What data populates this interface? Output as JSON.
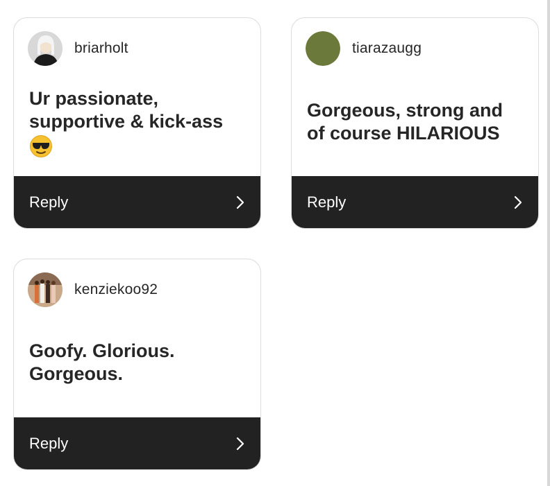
{
  "cards": [
    {
      "username": "briarholt",
      "message": "Ur passionate, supportive & kick-ass",
      "emoji": "sunglasses-emoji",
      "reply_label": "Reply",
      "avatar": "photo-portrait"
    },
    {
      "username": "tiarazaugg",
      "message": "Gorgeous, strong and of course HILARIOUS",
      "reply_label": "Reply",
      "avatar_color": "#6b7a3a"
    },
    {
      "username": "kenziekoo92",
      "message": "Goofy. Glorious. Gorgeous.",
      "reply_label": "Reply",
      "avatar": "photo-group"
    }
  ],
  "colors": {
    "reply_bar": "#222222",
    "card_border": "#dcdcdc",
    "text": "#262626"
  }
}
